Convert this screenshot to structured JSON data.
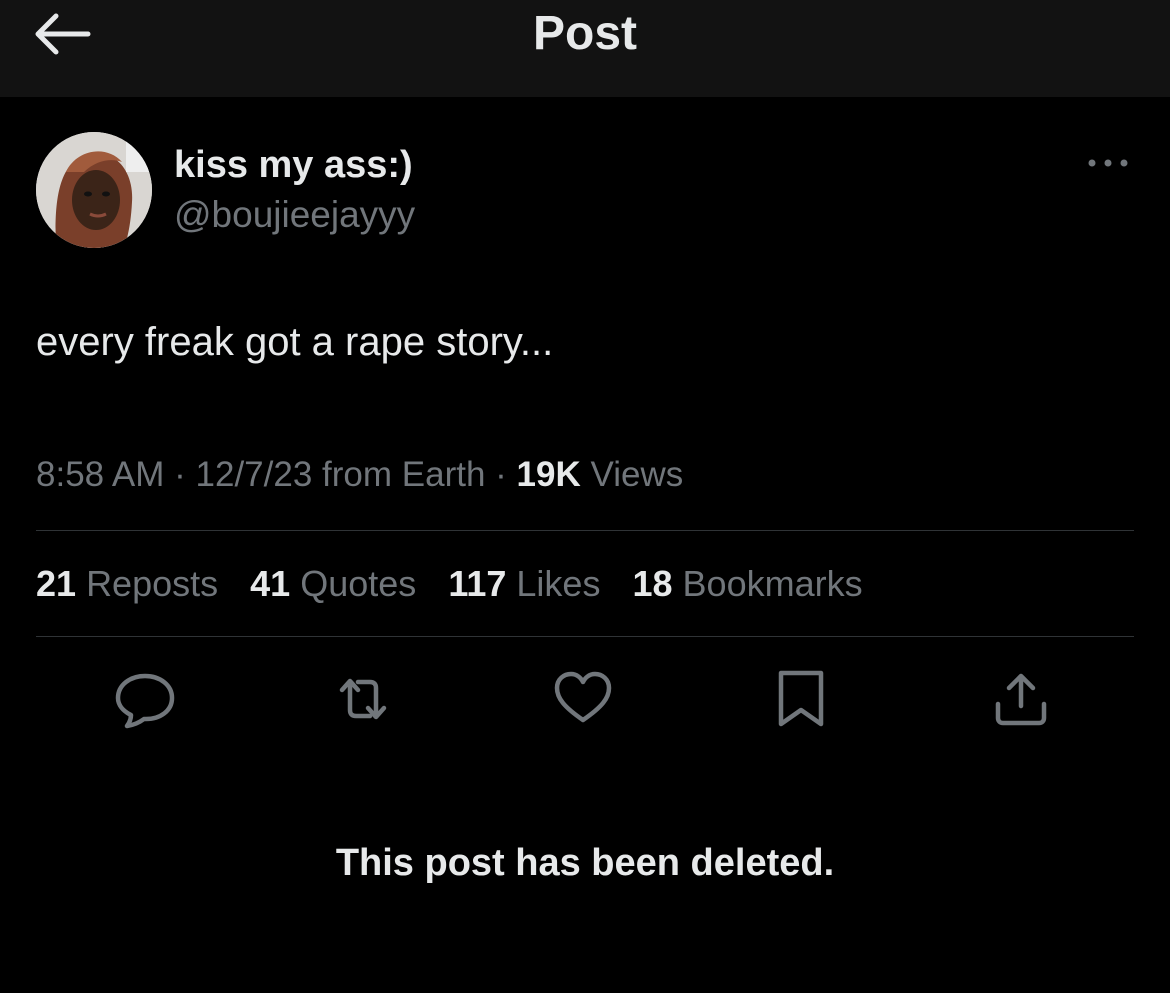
{
  "header": {
    "title": "Post"
  },
  "post": {
    "display_name": "kiss my ass:)",
    "handle": "@boujieejayyy",
    "text": "every freak got a rape story...",
    "time": "8:58 AM",
    "date": "12/7/23",
    "source": "from Earth",
    "views_count": "19K",
    "views_label": "Views",
    "sep": " · "
  },
  "stats": [
    {
      "count": "21",
      "label": "Reposts"
    },
    {
      "count": "41",
      "label": "Quotes"
    },
    {
      "count": "117",
      "label": "Likes"
    },
    {
      "count": "18",
      "label": "Bookmarks"
    }
  ],
  "actions": [
    "reply-icon",
    "repost-icon",
    "like-icon",
    "bookmark-icon",
    "share-icon"
  ],
  "notice": "This post has been deleted.",
  "colors": {
    "background": "#000000",
    "header": "#121212",
    "primary_text": "#e7e9ea",
    "secondary_text": "#71767b",
    "divider": "#2f3336"
  }
}
